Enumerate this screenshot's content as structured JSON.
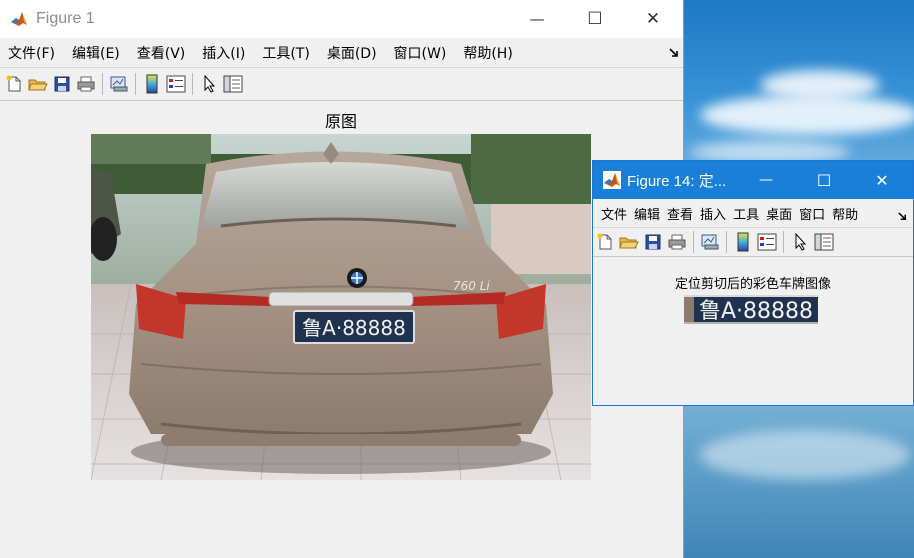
{
  "figure1": {
    "title": "Figure 1",
    "controls": {
      "minimize": "—",
      "maximize": "☐",
      "close": "✕"
    },
    "menu": [
      "文件(F)",
      "编辑(E)",
      "查看(V)",
      "插入(I)",
      "工具(T)",
      "桌面(D)",
      "窗口(W)",
      "帮助(H)"
    ],
    "axes_title": "原图",
    "plate_text": "鲁A·88888",
    "car_badge": "760 Li"
  },
  "figure14": {
    "title": "Figure 14: 定...",
    "controls": {
      "minimize": "—",
      "maximize": "☐",
      "close": "✕"
    },
    "menu": [
      "文件",
      "编辑",
      "查看",
      "插入",
      "工具",
      "桌面",
      "窗口",
      "帮助"
    ],
    "axes_title": "定位剪切后的彩色车牌图像",
    "plate_text": "鲁A·88888"
  },
  "colors": {
    "accent": "#1a7fd8",
    "plate_bg": "#1f3350"
  }
}
